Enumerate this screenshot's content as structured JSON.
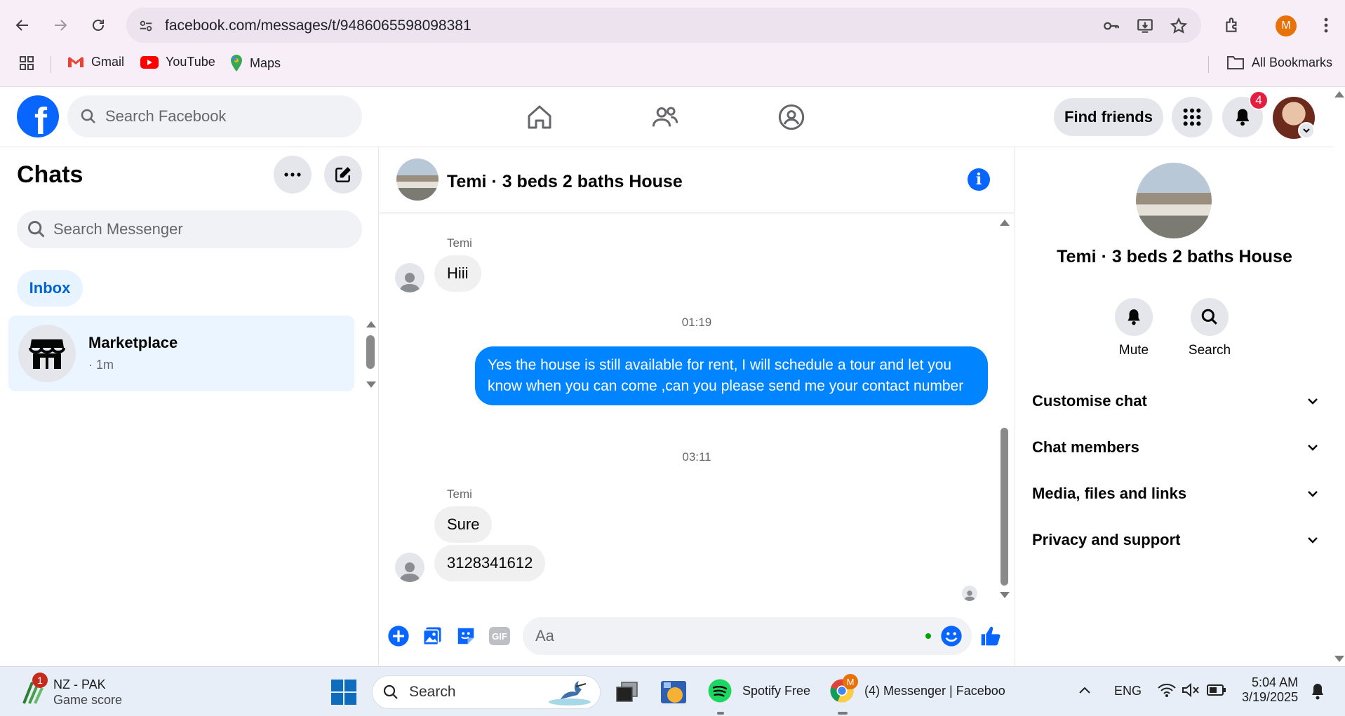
{
  "browser": {
    "url": "facebook.com/messages/t/9486065598098381",
    "profile_initial": "M",
    "bookmarks": [
      "Gmail",
      "YouTube",
      "Maps"
    ],
    "all_bookmarks": "All Bookmarks"
  },
  "fb_header": {
    "search_placeholder": "Search Facebook",
    "find_friends": "Find friends",
    "notification_count": "4"
  },
  "sidebar": {
    "title": "Chats",
    "search_placeholder": "Search Messenger",
    "filter_tab": "Inbox",
    "chats": [
      {
        "name": "Marketplace",
        "time": "· 1m"
      }
    ]
  },
  "conversation": {
    "title": "Temi · 3 beds 2 baths House",
    "messages": [
      {
        "sender": "Temi",
        "text": "Hiii"
      },
      {
        "time": "01:19"
      },
      {
        "sender": "me",
        "text": "Yes the house is still available for rent, I will schedule a tour and let you know when you can come ,can you please send me your contact number"
      },
      {
        "time": "03:11"
      },
      {
        "sender": "Temi",
        "text": "Sure"
      },
      {
        "sender": "Temi",
        "text": "3128341612"
      }
    ],
    "composer_placeholder": "Aa"
  },
  "info_panel": {
    "title": "Temi · 3 beds 2 baths House",
    "actions": [
      "Mute",
      "Search"
    ],
    "sections": [
      "Customise chat",
      "Chat members",
      "Media, files and links",
      "Privacy and support"
    ]
  },
  "taskbar": {
    "widget_title": "NZ - PAK",
    "widget_subtitle": "Game score",
    "widget_badge": "1",
    "search_placeholder": "Search",
    "apps": [
      "Spotify Free",
      "(4) Messenger | Faceboo"
    ],
    "language": "ENG",
    "time": "5:04 AM",
    "date": "3/19/2025",
    "chrome_badge": "M"
  },
  "colors": {
    "fb_blue": "#0866ff",
    "outgoing_bubble": "#0084ff",
    "notification_red": "#e41e3f",
    "inbox_active": "#e7f3ff"
  }
}
